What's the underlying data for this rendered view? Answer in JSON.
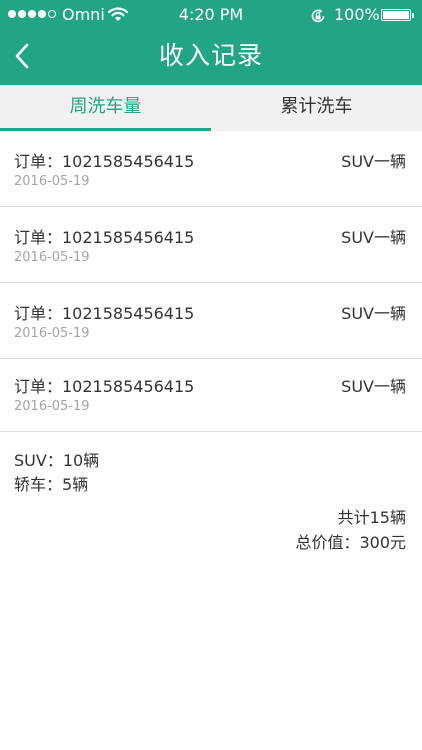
{
  "status_bar": {
    "carrier": "Omni",
    "time": "4:20 PM",
    "battery_percent": "100%",
    "signal_bars_filled": 4,
    "signal_bars_total": 5
  },
  "header": {
    "title": "收入记录",
    "background_color": "#22a585"
  },
  "tabs": [
    {
      "label": "周洗车量",
      "active": true
    },
    {
      "label": "累计洗车",
      "active": false
    }
  ],
  "orders": [
    {
      "order_number": "订单：1021585456415",
      "date": "2016-05-19",
      "vehicle": "SUV一辆"
    },
    {
      "order_number": "订单：1021585456415",
      "date": "2016-05-19",
      "vehicle": "SUV一辆"
    },
    {
      "order_number": "订单：1021585456415",
      "date": "2016-05-19",
      "vehicle": "SUV一辆"
    },
    {
      "order_number": "订单：1021585456415",
      "date": "2016-05-19",
      "vehicle": "SUV一辆"
    }
  ],
  "summary": {
    "suv_count": "SUV：10辆",
    "sedan_count": "轿车：5辆",
    "total_count": "共计15辆",
    "total_value": "总价值：300元"
  },
  "colors": {
    "accent": "#22a585",
    "tab_background": "#f1f1f1",
    "date_text": "#a4a4a4"
  },
  "icons": [
    "back-arrow-icon",
    "wifi-icon",
    "rotation-lock-icon",
    "battery-icon"
  ]
}
